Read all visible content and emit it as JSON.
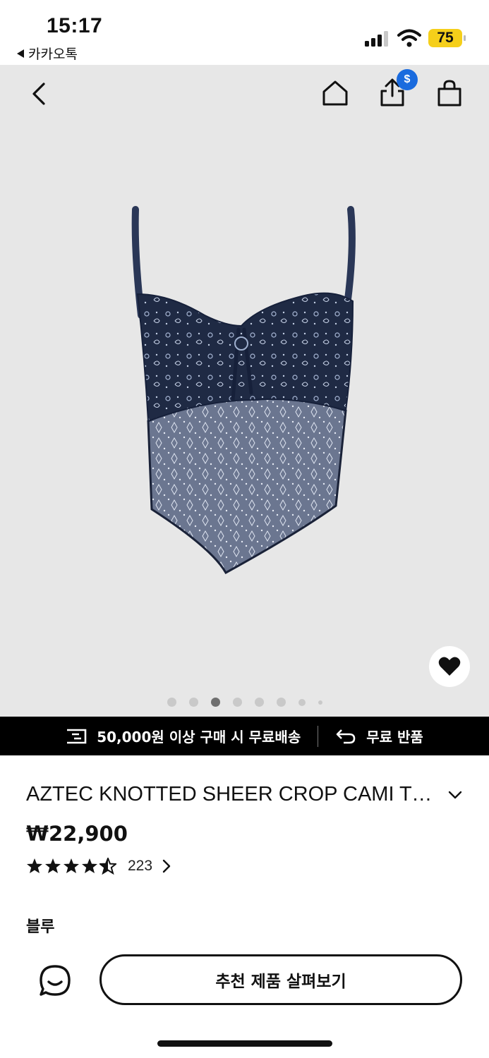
{
  "status_bar": {
    "time": "15:17",
    "back_app": "카카오톡",
    "battery": "75",
    "icons": [
      "signal-icon",
      "wifi-icon",
      "battery-icon"
    ]
  },
  "gallery": {
    "icons": [
      "back-icon",
      "home-icon",
      "share-icon",
      "bag-icon",
      "heart-icon"
    ],
    "share_badge": "$",
    "current_slide": 3,
    "slide_count": 8,
    "background_color": "#e7e7e7"
  },
  "banner": {
    "shipping": "50,000원 이상 구매 시 무료배송",
    "returns": "무료 반품",
    "icons": [
      "truck-icon",
      "return-arrow-icon"
    ]
  },
  "product": {
    "title": "AZTEC KNOTTED SHEER CROP CAMI TOP",
    "price": "₩22,900",
    "rating": 4.5,
    "review_count": "223",
    "color": "블루"
  },
  "bottom_bar": {
    "cta": "추천 제품 살펴보기",
    "icons": [
      "chat-icon"
    ]
  },
  "colors": {
    "accent_blue": "#1a6bde",
    "battery_yellow": "#f5cf1a",
    "banner_bg": "#000000",
    "product_navy": "#1f2a44"
  }
}
